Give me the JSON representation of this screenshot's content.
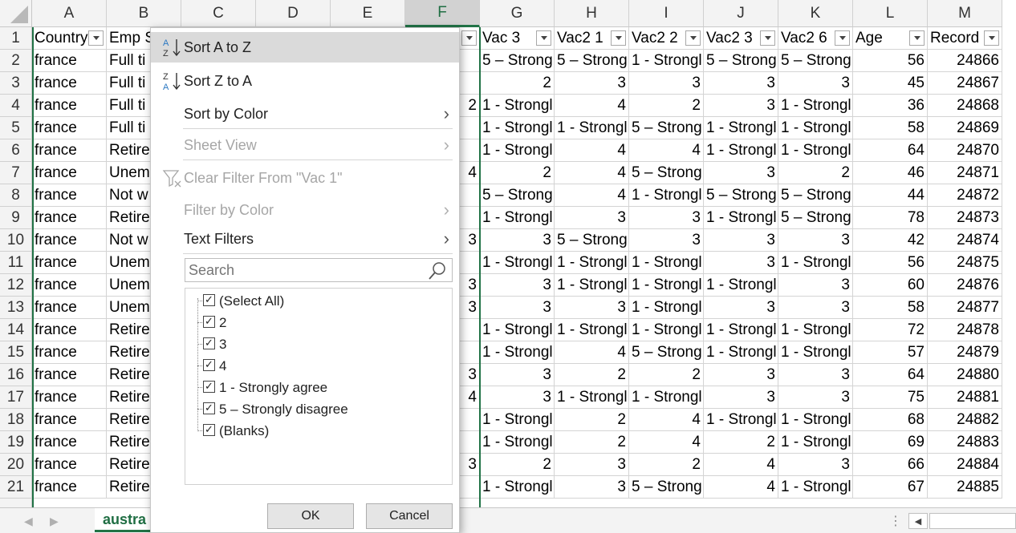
{
  "sheet": {
    "columns": [
      "A",
      "B",
      "C",
      "D",
      "E",
      "F",
      "G",
      "H",
      "I",
      "J",
      "K",
      "L",
      "M"
    ],
    "selected_column": "F",
    "header_row": [
      {
        "text": "Country",
        "filter": true
      },
      {
        "text": "Emp S",
        "filter": false
      },
      {
        "text": "",
        "filter": false
      },
      {
        "text": "",
        "filter": false
      },
      {
        "text": "",
        "filter": false
      },
      {
        "text": "",
        "filter": true
      },
      {
        "text": "Vac 3",
        "filter": true
      },
      {
        "text": "Vac2 1",
        "filter": true
      },
      {
        "text": "Vac2 2",
        "filter": true
      },
      {
        "text": "Vac2 3",
        "filter": true
      },
      {
        "text": "Vac2 6",
        "filter": true
      },
      {
        "text": "Age",
        "filter": true
      },
      {
        "text": "Record",
        "filter": true
      }
    ],
    "rows": [
      {
        "n": "2",
        "a": "france",
        "b": "Full ti",
        "f": "ong",
        "g": "5 – Strong",
        "h": "5 – Strong",
        "i": "1 - Strongl",
        "j": "5 – Strong",
        "k": "5 – Strong",
        "l": "56",
        "m": "24866"
      },
      {
        "n": "3",
        "a": "france",
        "b": "Full ti",
        "f": "ngl",
        "g": "2",
        "h": "3",
        "i": "3",
        "j": "3",
        "k": "3",
        "l": "45",
        "m": "24867"
      },
      {
        "n": "4",
        "a": "france",
        "b": "Full ti",
        "f": "2",
        "g": "1 - Strongl",
        "h": "4",
        "i": "2",
        "j": "3",
        "k": "1 - Strongl",
        "l": "36",
        "m": "24868"
      },
      {
        "n": "5",
        "a": "france",
        "b": "Full ti",
        "f": "ngl",
        "g": "1 - Strongl",
        "h": "1 - Strongl",
        "i": "5 – Strong",
        "j": "1 - Strongl",
        "k": "1 - Strongl",
        "l": "58",
        "m": "24869"
      },
      {
        "n": "6",
        "a": "france",
        "b": "Retire",
        "f": "ngl",
        "g": "1 - Strongl",
        "h": "4",
        "i": "4",
        "j": "1 - Strongl",
        "k": "1 - Strongl",
        "l": "64",
        "m": "24870"
      },
      {
        "n": "7",
        "a": "france",
        "b": "Unem",
        "f": "4",
        "g": "2",
        "h": "4",
        "i": "5 – Strong",
        "j": "3",
        "k": "2",
        "l": "46",
        "m": "24871"
      },
      {
        "n": "8",
        "a": "france",
        "b": "Not w",
        "f": "ong",
        "g": "5 – Strong",
        "h": "4",
        "i": "1 - Strongl",
        "j": "5 – Strong",
        "k": "5 – Strong",
        "l": "44",
        "m": "24872"
      },
      {
        "n": "9",
        "a": "france",
        "b": "Retire",
        "f": "ngl",
        "g": "1 - Strongl",
        "h": "3",
        "i": "3",
        "j": "1 - Strongl",
        "k": "5 – Strong",
        "l": "78",
        "m": "24873"
      },
      {
        "n": "10",
        "a": "france",
        "b": "Not w",
        "f": "3",
        "g": "3",
        "h": "5 – Strong",
        "i": "3",
        "j": "3",
        "k": "3",
        "l": "42",
        "m": "24874"
      },
      {
        "n": "11",
        "a": "france",
        "b": "Unem",
        "f": "ngl",
        "g": "1 - Strongl",
        "h": "1 - Strongl",
        "i": "1 - Strongl",
        "j": "3",
        "k": "1 - Strongl",
        "l": "56",
        "m": "24875"
      },
      {
        "n": "12",
        "a": "france",
        "b": "Unem",
        "f": "3",
        "g": "3",
        "h": "1 - Strongl",
        "i": "1 - Strongl",
        "j": "1 - Strongl",
        "k": "3",
        "l": "60",
        "m": "24876"
      },
      {
        "n": "13",
        "a": "france",
        "b": "Unem",
        "f": "3",
        "g": "3",
        "h": "3",
        "i": "1 - Strongl",
        "j": "3",
        "k": "3",
        "l": "58",
        "m": "24877"
      },
      {
        "n": "14",
        "a": "france",
        "b": "Retire",
        "f": "ngl",
        "g": "1 - Strongl",
        "h": "1 - Strongl",
        "i": "1 - Strongl",
        "j": "1 - Strongl",
        "k": "1 - Strongl",
        "l": "72",
        "m": "24878"
      },
      {
        "n": "15",
        "a": "france",
        "b": "Retire",
        "f": "ngl",
        "g": "1 - Strongl",
        "h": "4",
        "i": "5 – Strong",
        "j": "1 - Strongl",
        "k": "1 - Strongl",
        "l": "57",
        "m": "24879"
      },
      {
        "n": "16",
        "a": "france",
        "b": "Retire",
        "f": "3",
        "g": "3",
        "h": "2",
        "i": "2",
        "j": "3",
        "k": "3",
        "l": "64",
        "m": "24880"
      },
      {
        "n": "17",
        "a": "france",
        "b": "Retire",
        "f": "4",
        "g": "3",
        "h": "1 - Strongl",
        "i": "1 - Strongl",
        "j": "3",
        "k": "3",
        "l": "75",
        "m": "24881"
      },
      {
        "n": "18",
        "a": "france",
        "b": "Retire",
        "f": "ngl",
        "g": "1 - Strongl",
        "h": "2",
        "i": "4",
        "j": "1 - Strongl",
        "k": "1 - Strongl",
        "l": "68",
        "m": "24882"
      },
      {
        "n": "19",
        "a": "france",
        "b": "Retire",
        "f": "ngl",
        "g": "1 - Strongl",
        "h": "2",
        "i": "4",
        "j": "2",
        "k": "1 - Strongl",
        "l": "69",
        "m": "24883"
      },
      {
        "n": "20",
        "a": "france",
        "b": "Retire",
        "f": "3",
        "g": "2",
        "h": "3",
        "i": "2",
        "j": "4",
        "k": "3",
        "l": "66",
        "m": "24884"
      },
      {
        "n": "21",
        "a": "france",
        "b": "Retire",
        "f": "ngl",
        "g": "1 - Strongl",
        "h": "3",
        "i": "5 – Strong",
        "j": "4",
        "k": "1 - Strongl",
        "l": "67",
        "m": "24885"
      }
    ],
    "sheet_tab": "austra"
  },
  "menu": {
    "sort_az": "Sort A to Z",
    "sort_za": "Sort Z to A",
    "sort_by_color": "Sort by Color",
    "sheet_view": "Sheet View",
    "clear_filter": "Clear Filter From \"Vac 1\"",
    "filter_by_color": "Filter by Color",
    "text_filters": "Text Filters",
    "search_placeholder": "Search",
    "items": [
      "(Select All)",
      "2",
      "3",
      "4",
      "1 - Strongly agree",
      "5 – Strongly disagree",
      "(Blanks)"
    ],
    "ok": "OK",
    "cancel": "Cancel"
  },
  "colors": {
    "accent": "#217346",
    "hover": "#dadada",
    "disabled": "#a6a6a6"
  },
  "icons": [
    "sort-az-icon",
    "sort-za-icon",
    "chevron-right-icon",
    "clear-filter-icon",
    "search-icon",
    "checkbox-checked-icon",
    "filter-dropdown-icon"
  ]
}
